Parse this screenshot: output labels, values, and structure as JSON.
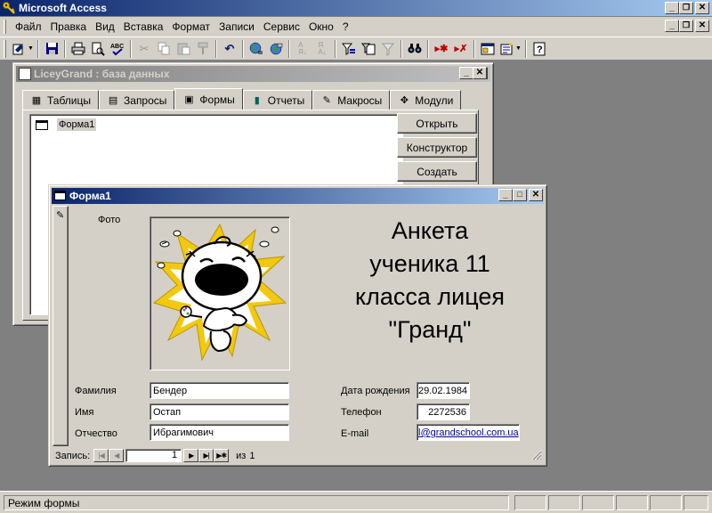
{
  "app": {
    "title": "Microsoft Access",
    "controls": {
      "minimize": "_",
      "restore": "❐",
      "close": "✕"
    }
  },
  "menu": [
    "Файл",
    "Правка",
    "Вид",
    "Вставка",
    "Формат",
    "Записи",
    "Сервис",
    "Окно",
    "?"
  ],
  "toolbar": {
    "buttons": [
      "view-icon",
      "save-icon",
      "print-icon",
      "print-preview-icon",
      "spelling-icon",
      "cut-icon",
      "copy-icon",
      "paste-icon",
      "format-painter-icon",
      "undo-icon",
      "hyperlink-icon",
      "web-toolbar-icon",
      "sort-ascending-icon",
      "sort-descending-icon",
      "filter-by-selection-icon",
      "filter-by-form-icon",
      "apply-filter-icon",
      "find-icon",
      "new-record-icon",
      "delete-record-icon",
      "database-window-icon",
      "new-object-icon",
      "help-icon"
    ]
  },
  "db_window": {
    "title": "LiceyGrand : база данных",
    "tabs": [
      "Таблицы",
      "Запросы",
      "Формы",
      "Отчеты",
      "Макросы",
      "Модули"
    ],
    "active_tab": "Формы",
    "items": [
      "Форма1"
    ],
    "buttons": {
      "open": "Открыть",
      "design": "Конструктор",
      "create": "Создать"
    }
  },
  "form_window": {
    "title": "Форма1",
    "photo_label": "Фото",
    "heading": [
      "Анкета",
      "ученика 11",
      "класса лицея",
      "\"Гранд\""
    ],
    "fields": {
      "surname_label": "Фамилия",
      "surname": "Бендер",
      "name_label": "Имя",
      "name": "Остап",
      "patronymic_label": "Отчество",
      "patronymic": "Ибрагимович",
      "birthdate_label": "Дата рождения",
      "birthdate": "29.02.1984",
      "phone_label": "Телефон",
      "phone": "2272536",
      "email_label": "E-mail",
      "email": "l@grandschool.com.ua"
    },
    "navigator": {
      "label": "Запись:",
      "current": "1",
      "of_label": "из",
      "total": "1"
    }
  },
  "status": {
    "text": "Режим формы"
  },
  "colors": {
    "face": "#d4d0c8",
    "active_title": "#0a246a",
    "inactive_title": "#808080",
    "desktop": "#808080",
    "sun": "#f2c810"
  }
}
